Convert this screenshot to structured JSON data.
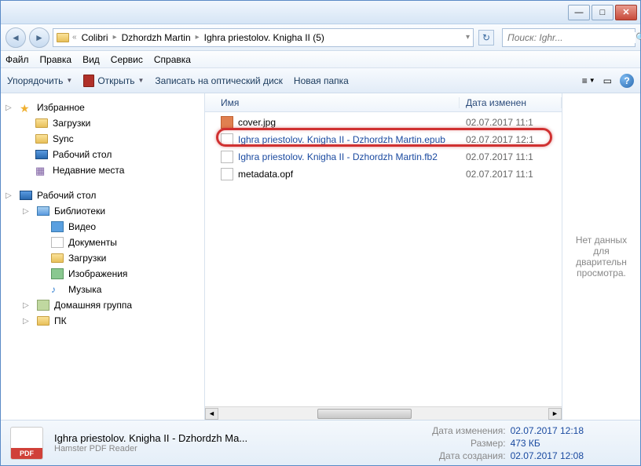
{
  "breadcrumb": {
    "root": "Colibri",
    "mid": "Dzhordzh Martin",
    "leaf": "Ighra priestolov. Knigha II (5)"
  },
  "search": {
    "placeholder": "Поиск: Ighr..."
  },
  "menu": {
    "file": "Файл",
    "edit": "Правка",
    "view": "Вид",
    "tools": "Сервис",
    "help": "Справка"
  },
  "toolbar": {
    "organize": "Упорядочить",
    "open": "Открыть",
    "burn": "Записать на оптический диск",
    "newfolder": "Новая папка"
  },
  "nav": {
    "favorites": "Избранное",
    "downloads": "Загрузки",
    "sync": "Sync",
    "desktop": "Рабочий стол",
    "recent": "Недавние места",
    "desktop2": "Рабочий стол",
    "libraries": "Библиотеки",
    "videos": "Видео",
    "documents": "Документы",
    "downloads2": "Загрузки",
    "pictures": "Изображения",
    "music": "Музыка",
    "homegroup": "Домашняя группа",
    "pc": "ПК"
  },
  "cols": {
    "name": "Имя",
    "date": "Дата изменен"
  },
  "files": [
    {
      "name": "cover.jpg",
      "date": "02.07.2017 11:1",
      "link": false
    },
    {
      "name": "Ighra priestolov. Knigha II - Dzhordzh Martin.epub",
      "date": "02.07.2017 12:1",
      "link": true
    },
    {
      "name": "Ighra priestolov. Knigha II - Dzhordzh Martin.fb2",
      "date": "02.07.2017 11:1",
      "link": true
    },
    {
      "name": "metadata.opf",
      "date": "02.07.2017 11:1",
      "link": false
    }
  ],
  "preview": {
    "text": "Нет данных для дварительн просмотра."
  },
  "status": {
    "filename": "Ighra priestolov. Knigha II - Dzhordzh Ma...",
    "app": "Hamster PDF Reader",
    "pdf": "PDF",
    "props": {
      "modified_lbl": "Дата изменения:",
      "modified_val": "02.07.2017 12:18",
      "size_lbl": "Размер:",
      "size_val": "473 КБ",
      "created_lbl": "Дата создания:",
      "created_val": "02.07.2017 12:08"
    }
  }
}
